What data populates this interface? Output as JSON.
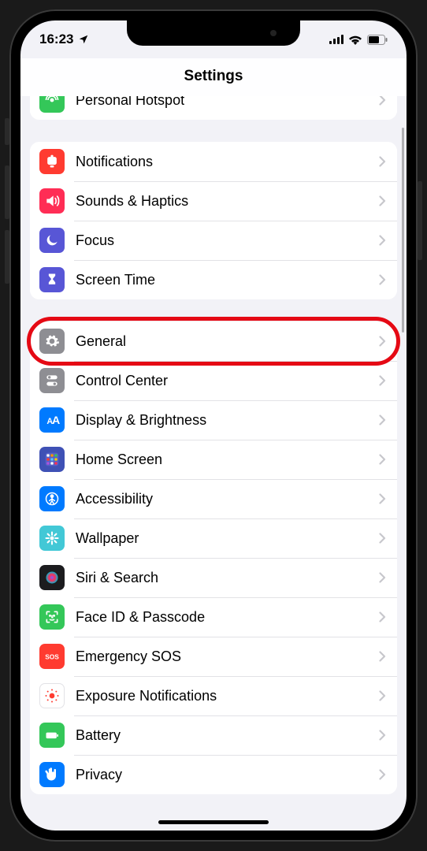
{
  "status": {
    "time": "16:23"
  },
  "nav": {
    "title": "Settings"
  },
  "groups": [
    {
      "partial": true,
      "rows": [
        {
          "id": "personal-hotspot",
          "label": "Personal Hotspot",
          "icon": "hotspot",
          "bg": "#34c759"
        }
      ]
    },
    {
      "rows": [
        {
          "id": "notifications",
          "label": "Notifications",
          "icon": "bell",
          "bg": "#ff3b30"
        },
        {
          "id": "sounds-haptics",
          "label": "Sounds & Haptics",
          "icon": "speaker",
          "bg": "#ff2d55"
        },
        {
          "id": "focus",
          "label": "Focus",
          "icon": "moon",
          "bg": "#5856d6"
        },
        {
          "id": "screen-time",
          "label": "Screen Time",
          "icon": "hourglass",
          "bg": "#5856d6"
        }
      ]
    },
    {
      "rows": [
        {
          "id": "general",
          "label": "General",
          "icon": "gear",
          "bg": "#8e8e93",
          "highlighted": true
        },
        {
          "id": "control-center",
          "label": "Control Center",
          "icon": "switches",
          "bg": "#8e8e93"
        },
        {
          "id": "display-brightness",
          "label": "Display & Brightness",
          "icon": "aa",
          "bg": "#007aff"
        },
        {
          "id": "home-screen",
          "label": "Home Screen",
          "icon": "grid",
          "bg": "#3f51b5"
        },
        {
          "id": "accessibility",
          "label": "Accessibility",
          "icon": "person",
          "bg": "#007aff"
        },
        {
          "id": "wallpaper",
          "label": "Wallpaper",
          "icon": "flower",
          "bg": "#42c8d6"
        },
        {
          "id": "siri-search",
          "label": "Siri & Search",
          "icon": "siri",
          "bg": "#1c1c1e"
        },
        {
          "id": "face-id",
          "label": "Face ID & Passcode",
          "icon": "face",
          "bg": "#34c759"
        },
        {
          "id": "emergency-sos",
          "label": "Emergency SOS",
          "icon": "sos",
          "bg": "#ff3b30"
        },
        {
          "id": "exposure",
          "label": "Exposure Notifications",
          "icon": "exposure",
          "bg": "#ffffff"
        },
        {
          "id": "battery",
          "label": "Battery",
          "icon": "battery",
          "bg": "#34c759"
        },
        {
          "id": "privacy",
          "label": "Privacy",
          "icon": "hand",
          "bg": "#007aff"
        }
      ]
    }
  ]
}
